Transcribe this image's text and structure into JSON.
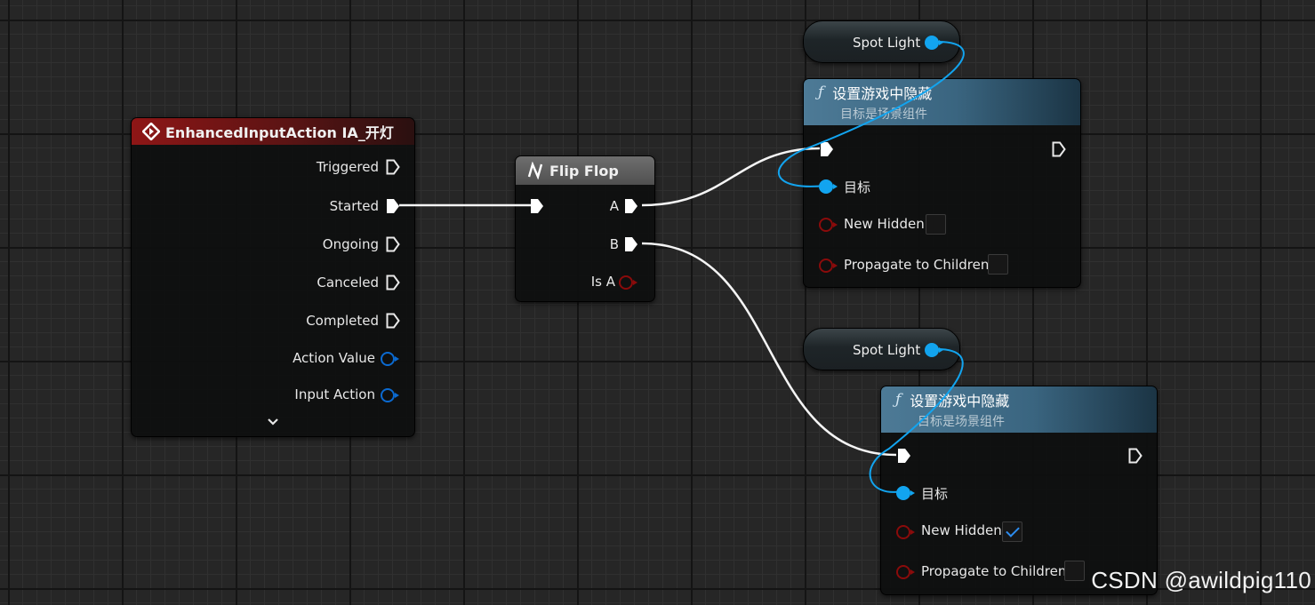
{
  "event_node": {
    "title": "EnhancedInputAction IA_开灯",
    "pins": [
      "Triggered",
      "Started",
      "Ongoing",
      "Canceled",
      "Completed",
      "Action Value",
      "Input Action"
    ],
    "expand_icon": "chevron-down-icon"
  },
  "flipflop_node": {
    "title": "Flip Flop",
    "icon": "flipflop-icon",
    "outputs": [
      "A",
      "B",
      "Is A"
    ]
  },
  "var_node_1": {
    "label": "Spot Light"
  },
  "var_node_2": {
    "label": "Spot Light"
  },
  "func_node_1": {
    "title": "设置游戏中隐藏",
    "subtitle": "目标是场景组件",
    "target_label": "目标",
    "new_hidden_label": "New Hidden",
    "new_hidden_checked": false,
    "propagate_label": "Propagate to Children",
    "propagate_checked": false
  },
  "func_node_2": {
    "title": "设置游戏中隐藏",
    "subtitle": "目标是场景组件",
    "target_label": "目标",
    "new_hidden_label": "New Hidden",
    "new_hidden_checked": true,
    "propagate_label": "Propagate to Children",
    "propagate_checked": false
  },
  "colors": {
    "exec_wire": "#ffffff",
    "object_pin": "#12a4ef",
    "bool_pin": "#8a0b0b",
    "struct_pin": "#0b6ad1",
    "event_header": "#8e1616",
    "function_header": "#4d7a96"
  },
  "watermark": "CSDN @awildpig110"
}
